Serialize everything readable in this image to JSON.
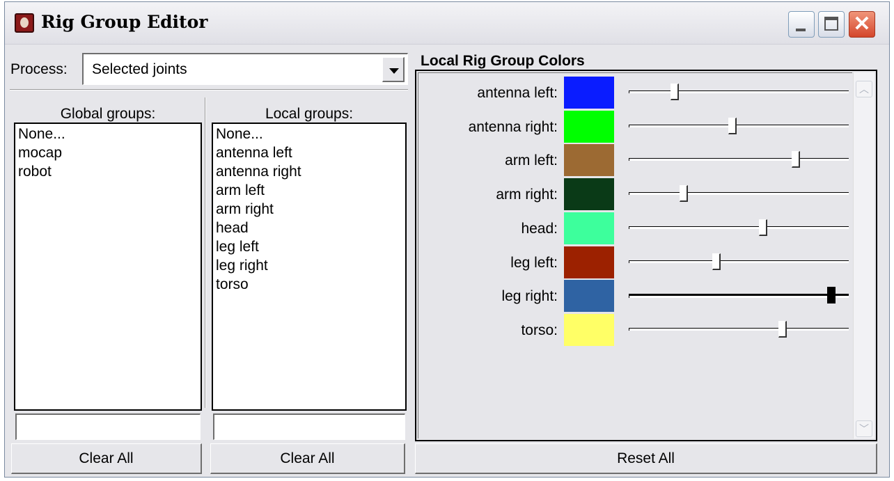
{
  "window": {
    "title": "Rig Group Editor",
    "close_glyph": "✕"
  },
  "process": {
    "label": "Process:",
    "value": "Selected joints"
  },
  "global_groups": {
    "header": "Global groups:",
    "items": [
      "None...",
      "mocap",
      "robot"
    ],
    "filter": "",
    "clear_label": "Clear All"
  },
  "local_groups": {
    "header": "Local groups:",
    "items": [
      "None...",
      "antenna left",
      "antenna right",
      "arm left",
      "arm right",
      "head",
      "leg left",
      "leg right",
      "torso"
    ],
    "filter": "",
    "clear_label": "Clear All"
  },
  "colors": {
    "title": "Local Rig Group Colors",
    "rows": [
      {
        "label": "antenna left:",
        "color": "#0a1cff",
        "slider": 0.21
      },
      {
        "label": "antenna right:",
        "color": "#00ff00",
        "slider": 0.47
      },
      {
        "label": "arm left:",
        "color": "#9c6a33",
        "slider": 0.76
      },
      {
        "label": "arm right:",
        "color": "#0a3a17",
        "slider": 0.25
      },
      {
        "label": "head:",
        "color": "#3dff9c",
        "slider": 0.61
      },
      {
        "label": "leg left:",
        "color": "#9c2100",
        "slider": 0.4
      },
      {
        "label": "leg right:",
        "color": "#2f63a3",
        "slider": 0.92
      },
      {
        "label": "torso:",
        "color": "#ffff66",
        "slider": 0.7
      }
    ],
    "reset_label": "Reset All"
  }
}
